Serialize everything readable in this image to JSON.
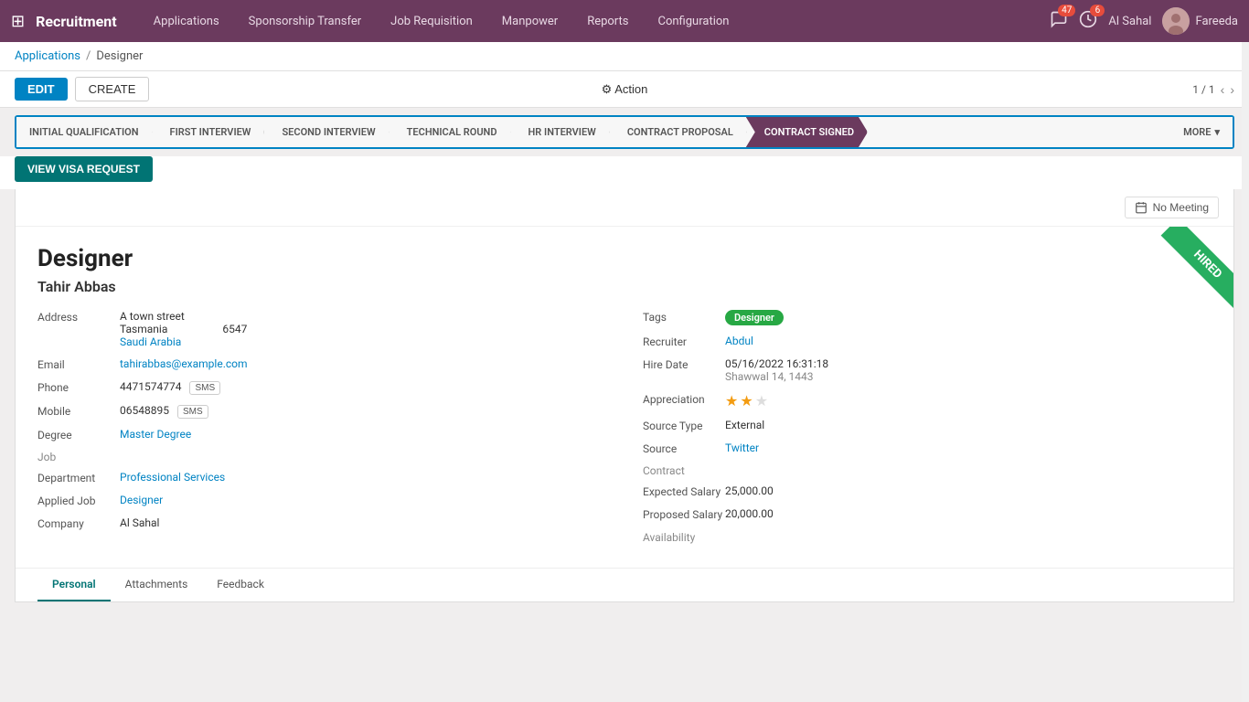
{
  "app": {
    "brand": "Recruitment",
    "grid_icon": "⊞"
  },
  "nav": {
    "links": [
      {
        "label": "Applications",
        "id": "applications"
      },
      {
        "label": "Sponsorship Transfer",
        "id": "sponsorship"
      },
      {
        "label": "Job Requisition",
        "id": "job-req"
      },
      {
        "label": "Manpower",
        "id": "manpower"
      },
      {
        "label": "Reports",
        "id": "reports"
      },
      {
        "label": "Configuration",
        "id": "configuration"
      }
    ]
  },
  "nav_right": {
    "messages_badge": "47",
    "activity_badge": "6",
    "company": "Al Sahal",
    "user": "Fareeda"
  },
  "breadcrumb": {
    "parent": "Applications",
    "separator": "/",
    "current": "Designer"
  },
  "toolbar": {
    "edit_label": "EDIT",
    "create_label": "CREATE",
    "action_label": "⚙ Action",
    "pager": "1 / 1",
    "view_visa_label": "VIEW VISA REQUEST"
  },
  "stages": [
    {
      "label": "INITIAL QUALIFICATION",
      "active": false
    },
    {
      "label": "FIRST INTERVIEW",
      "active": false
    },
    {
      "label": "SECOND INTERVIEW",
      "active": false
    },
    {
      "label": "TECHNICAL ROUND",
      "active": false
    },
    {
      "label": "HR INTERVIEW",
      "active": false
    },
    {
      "label": "CONTRACT PROPOSAL",
      "active": false
    },
    {
      "label": "CONTRACT SIGNED",
      "active": true
    }
  ],
  "stages_more": "MORE",
  "no_meeting": "No Meeting",
  "record": {
    "title": "Designer",
    "applicant": "Tahir Abbas",
    "hired_label": "HIRED",
    "status_dot_color": "#ccc"
  },
  "left_fields": {
    "address_label": "Address",
    "address_line1": "A town street",
    "address_line2": "Tasmania",
    "address_code": "6547",
    "address_country": "Saudi Arabia",
    "email_label": "Email",
    "email_value": "tahirabbas@example.com",
    "phone_label": "Phone",
    "phone_value": "4471574774",
    "phone_sms": "SMS",
    "mobile_label": "Mobile",
    "mobile_value": "06548895",
    "mobile_sms": "SMS",
    "degree_label": "Degree",
    "degree_value": "Master Degree",
    "job_section": "Job",
    "department_label": "Department",
    "department_value": "Professional Services",
    "applied_job_label": "Applied Job",
    "applied_job_value": "Designer",
    "company_label": "Company",
    "company_value": "Al Sahal"
  },
  "right_fields": {
    "tags_label": "Tags",
    "tags_value": "Designer",
    "recruiter_label": "Recruiter",
    "recruiter_value": "Abdul",
    "hire_date_label": "Hire Date",
    "hire_date_value": "05/16/2022 16:31:18",
    "hire_date_hijri": "Shawwal 14, 1443",
    "appreciation_label": "Appreciation",
    "appreciation_stars": 2,
    "appreciation_max": 3,
    "source_type_label": "Source Type",
    "source_type_value": "External",
    "source_label": "Source",
    "source_value": "Twitter",
    "contract_section": "Contract",
    "expected_salary_label": "Expected Salary",
    "expected_salary_value": "25,000.00",
    "proposed_salary_label": "Proposed Salary",
    "proposed_salary_value": "20,000.00",
    "availability_label": "Availability"
  },
  "tabs": [
    {
      "label": "Personal",
      "active": true
    },
    {
      "label": "Attachments",
      "active": false
    },
    {
      "label": "Feedback",
      "active": false
    }
  ]
}
